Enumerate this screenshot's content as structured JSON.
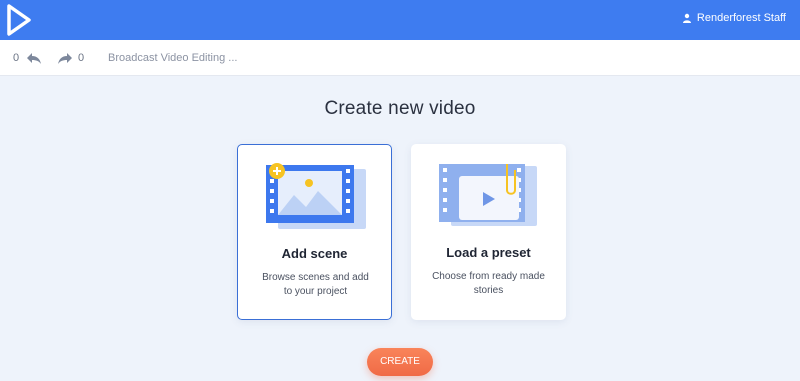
{
  "header": {
    "user_name": "Renderforest Staff"
  },
  "toolbar": {
    "undo_count": "0",
    "redo_count": "0",
    "project_title": "Broadcast Video Editing ..."
  },
  "main": {
    "heading": "Create new video",
    "cards": [
      {
        "title": "Add scene",
        "description": "Browse scenes and add to your project"
      },
      {
        "title": "Load a preset",
        "description": "Choose from ready made stories"
      }
    ],
    "create_label": "CREATE"
  },
  "colors": {
    "brand_blue": "#3e7cf0",
    "create_orange": "#f06a46",
    "selected_border": "#3a6fd6"
  }
}
